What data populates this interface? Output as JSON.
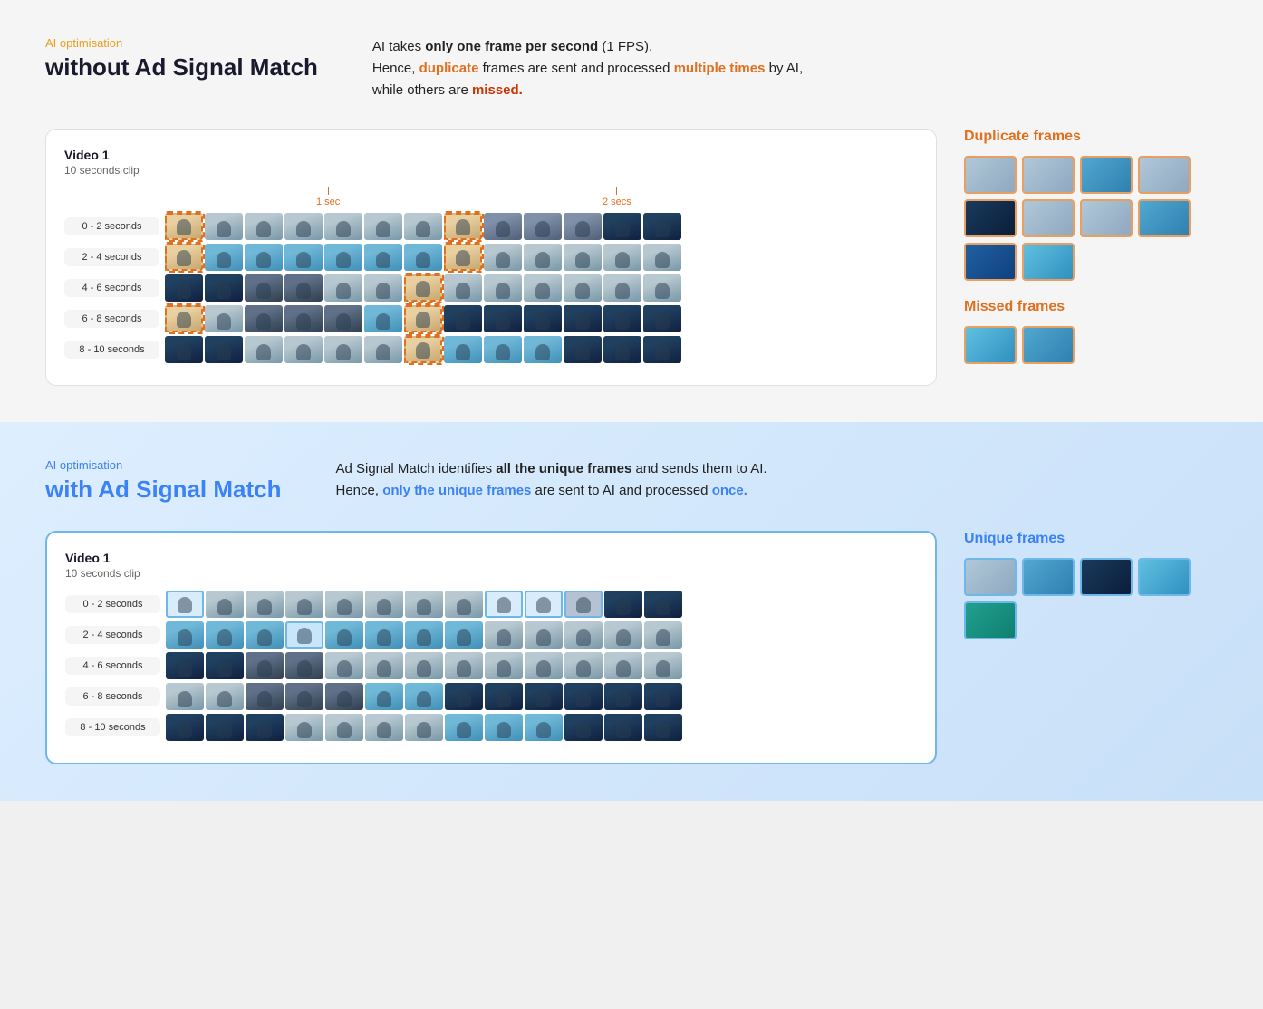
{
  "top": {
    "subtitle": "AI optimisation",
    "title_line1": "without Ad Signal Match",
    "desc_part1": "AI takes ",
    "desc_bold": "only one frame per second",
    "desc_part2": " (1 FPS).",
    "desc_line2_part1": "Hence, ",
    "desc_line2_dup": "duplicate",
    "desc_line2_part2": " frames are sent and processed ",
    "desc_line2_mult": "multiple times",
    "desc_line2_part3": " by AI,",
    "desc_line3_part1": "while others are ",
    "desc_line3_missed": "missed.",
    "video_label": "Video 1",
    "video_sublabel": "10 seconds clip",
    "time_marker1": "1 sec",
    "time_marker2": "2 secs",
    "rows": [
      {
        "label": "0 - 2 seconds"
      },
      {
        "label": "2 - 4 seconds"
      },
      {
        "label": "4 - 6 seconds"
      },
      {
        "label": "6 - 8 seconds"
      },
      {
        "label": "8 - 10 seconds"
      }
    ],
    "side_dup_title_before": " frames",
    "side_dup_orange": "Duplicate",
    "side_missed_title_before": " frames",
    "side_missed_orange": "Missed"
  },
  "bottom": {
    "subtitle": "AI optimisation",
    "title_line1": "with Ad Signal Match",
    "desc_part1": "Ad Signal Match identifies ",
    "desc_bold": "all the unique frames",
    "desc_part2": " and sends them to AI.",
    "desc_line2_part1": "Hence, ",
    "desc_line2_unique": "only the unique frames",
    "desc_line2_part2": " are sent to AI and processed ",
    "desc_line2_once": "once.",
    "video_label": "Video 1",
    "video_sublabel": "10 seconds clip",
    "rows": [
      {
        "label": "0 - 2 seconds"
      },
      {
        "label": "2 - 4 seconds"
      },
      {
        "label": "4 - 6 seconds"
      },
      {
        "label": "6 - 8 seconds"
      },
      {
        "label": "8 - 10 seconds"
      }
    ],
    "side_unique_title_before": " frames",
    "side_unique_blue": "Unique"
  }
}
